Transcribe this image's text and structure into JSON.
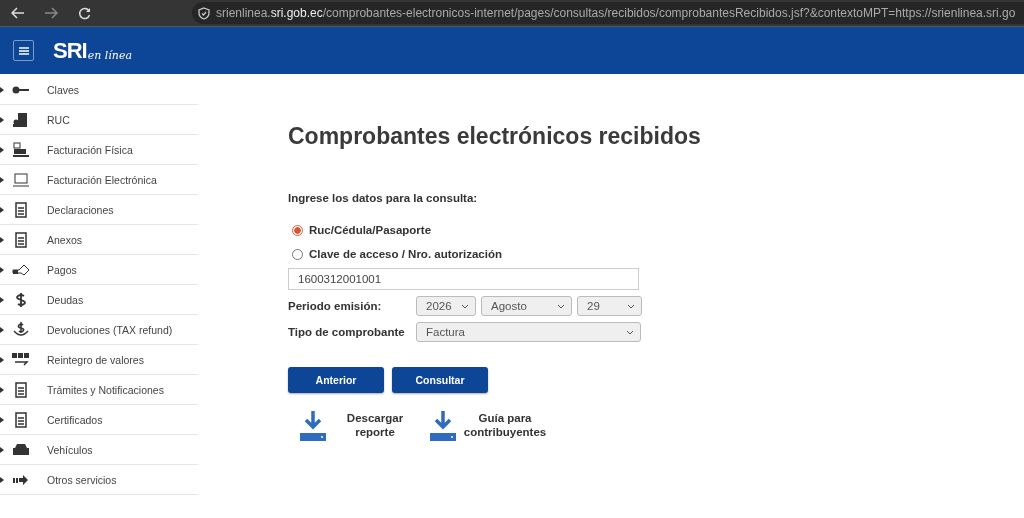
{
  "browser": {
    "url": "srienlinea.**sri.gob.ec**/comprobantes-electronicos-internet/pages/consultas/recibidos/comprobantesRecibidos.jsf?&contextoMPT=https://srienlinea.sri.go"
  },
  "header": {
    "logo_main": "SRI",
    "logo_script": "en línea"
  },
  "sidebar": {
    "items": [
      {
        "label": "Claves"
      },
      {
        "label": "RUC"
      },
      {
        "label": "Facturación Física"
      },
      {
        "label": "Facturación Electrónica"
      },
      {
        "label": "Declaraciones"
      },
      {
        "label": "Anexos"
      },
      {
        "label": "Pagos"
      },
      {
        "label": "Deudas"
      },
      {
        "label": "Devoluciones (TAX refund)"
      },
      {
        "label": "Reintegro de valores"
      },
      {
        "label": "Trámites y Notificaciones"
      },
      {
        "label": "Certificados"
      },
      {
        "label": "Vehículos"
      },
      {
        "label": "Otros servicios"
      }
    ]
  },
  "main": {
    "title": "Comprobantes electrónicos recibidos",
    "prompt": "Ingrese los datos para la consulta:",
    "options": [
      {
        "label": "Ruc/Cédula/Pasaporte",
        "selected": true
      },
      {
        "label": "Clave de acceso / Nro. autorización",
        "selected": false
      }
    ],
    "id_field": {
      "value": "1600312001001"
    },
    "period": {
      "label": "Periodo emisión:",
      "year": "2026",
      "month": "Agosto",
      "day": "29"
    },
    "type": {
      "label": "Tipo de comprobante",
      "value": "Factura"
    },
    "buttons": [
      "Anterior",
      "Consultar"
    ],
    "downloads": [
      {
        "label": "Descargar reporte"
      },
      {
        "label": "Guía para contribuyentes"
      }
    ]
  }
}
